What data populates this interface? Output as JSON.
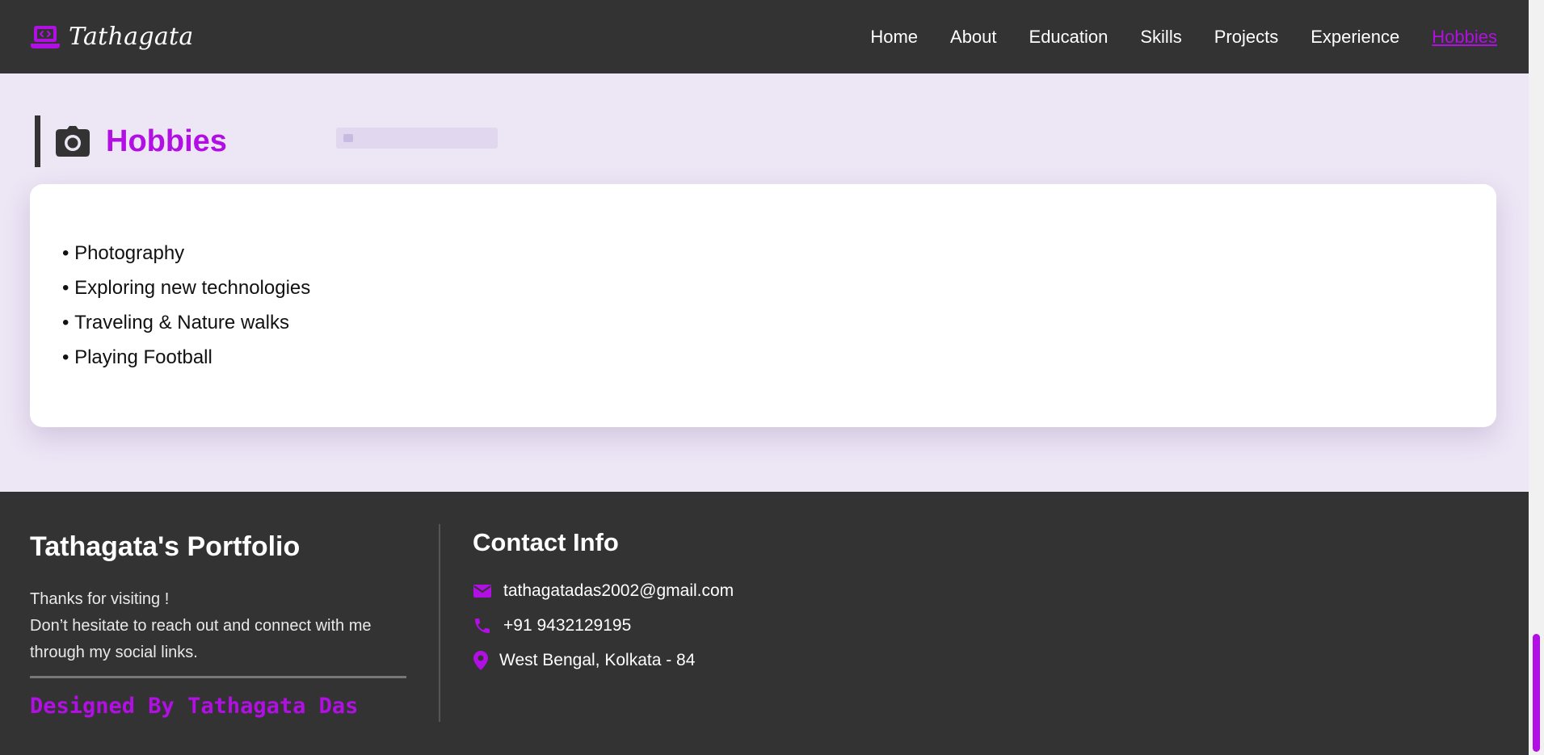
{
  "colors": {
    "accent": "#b10fe3",
    "dark": "#333333",
    "section_bg": "#ede6f5"
  },
  "header": {
    "brand_icon": "laptop-code-icon",
    "brand_name": "Tathagata",
    "nav": [
      {
        "label": "Home"
      },
      {
        "label": "About"
      },
      {
        "label": "Education"
      },
      {
        "label": "Skills"
      },
      {
        "label": "Projects"
      },
      {
        "label": "Experience"
      },
      {
        "label": "Hobbies",
        "active": true
      }
    ]
  },
  "hobbies": {
    "icon": "camera-icon",
    "title": "Hobbies",
    "items": [
      "Photography",
      "Exploring new technologies",
      "Traveling & Nature walks",
      "Playing Football"
    ]
  },
  "footer": {
    "title": "Tathagata's Portfolio",
    "thanks": "Thanks for visiting !",
    "message": "Don’t hesitate to reach out and connect with me through my social links.",
    "designed_by": "Designed By Tathagata Das",
    "contact": {
      "title": "Contact Info",
      "email": "tathagatadas2002@gmail.com",
      "phone": "+91 9432129195",
      "location": "West Bengal, Kolkata - 84"
    }
  }
}
